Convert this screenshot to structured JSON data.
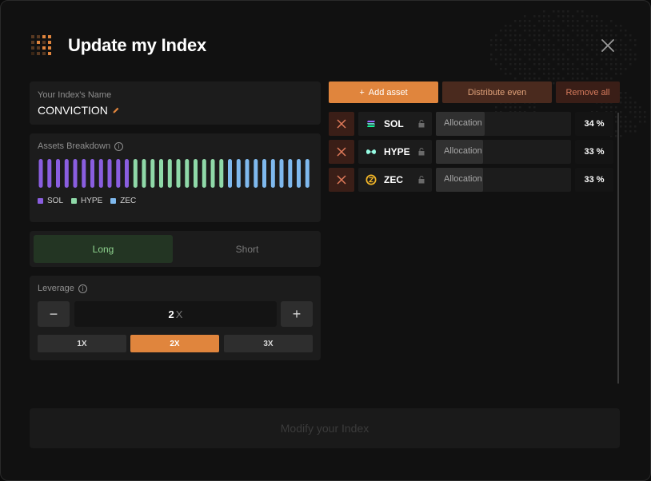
{
  "modal": {
    "title": "Update my Index"
  },
  "index_name": {
    "label": "Your Index's Name",
    "value": "CONVICTION"
  },
  "breakdown": {
    "label": "Assets Breakdown",
    "legend": [
      {
        "ticker": "SOL",
        "color": "#8a5ee0"
      },
      {
        "ticker": "HYPE",
        "color": "#8fd9a8"
      },
      {
        "ticker": "ZEC",
        "color": "#7fb9ee"
      }
    ],
    "segments": [
      {
        "ticker": "SOL",
        "bars": 11
      },
      {
        "ticker": "HYPE",
        "bars": 11
      },
      {
        "ticker": "ZEC",
        "bars": 10
      }
    ]
  },
  "direction": {
    "long_label": "Long",
    "short_label": "Short",
    "selected": "Long"
  },
  "leverage": {
    "label": "Leverage",
    "value": "2",
    "unit": "X",
    "minus": "−",
    "plus": "+",
    "presets": [
      "1X",
      "2X",
      "3X"
    ],
    "selected": "2X"
  },
  "actions": {
    "add_asset": "Add asset",
    "add_icon": "+",
    "distribute": "Distribute even",
    "remove_all": "Remove all"
  },
  "assets": [
    {
      "ticker": "SOL",
      "icon": "solana-logo-icon",
      "alloc_label": "Allocation",
      "percent": "34 %",
      "fraction": 0.34
    },
    {
      "ticker": "HYPE",
      "icon": "hyperliquid-logo-icon",
      "alloc_label": "Allocation",
      "percent": "33 %",
      "fraction": 0.33
    },
    {
      "ticker": "ZEC",
      "icon": "zcash-logo-icon",
      "alloc_label": "Allocation",
      "percent": "33 %",
      "fraction": 0.33
    }
  ],
  "footer": {
    "modify_label": "Modify your Index"
  },
  "colors": {
    "accent": "#e0853d",
    "long_green": "#8fd48f"
  }
}
